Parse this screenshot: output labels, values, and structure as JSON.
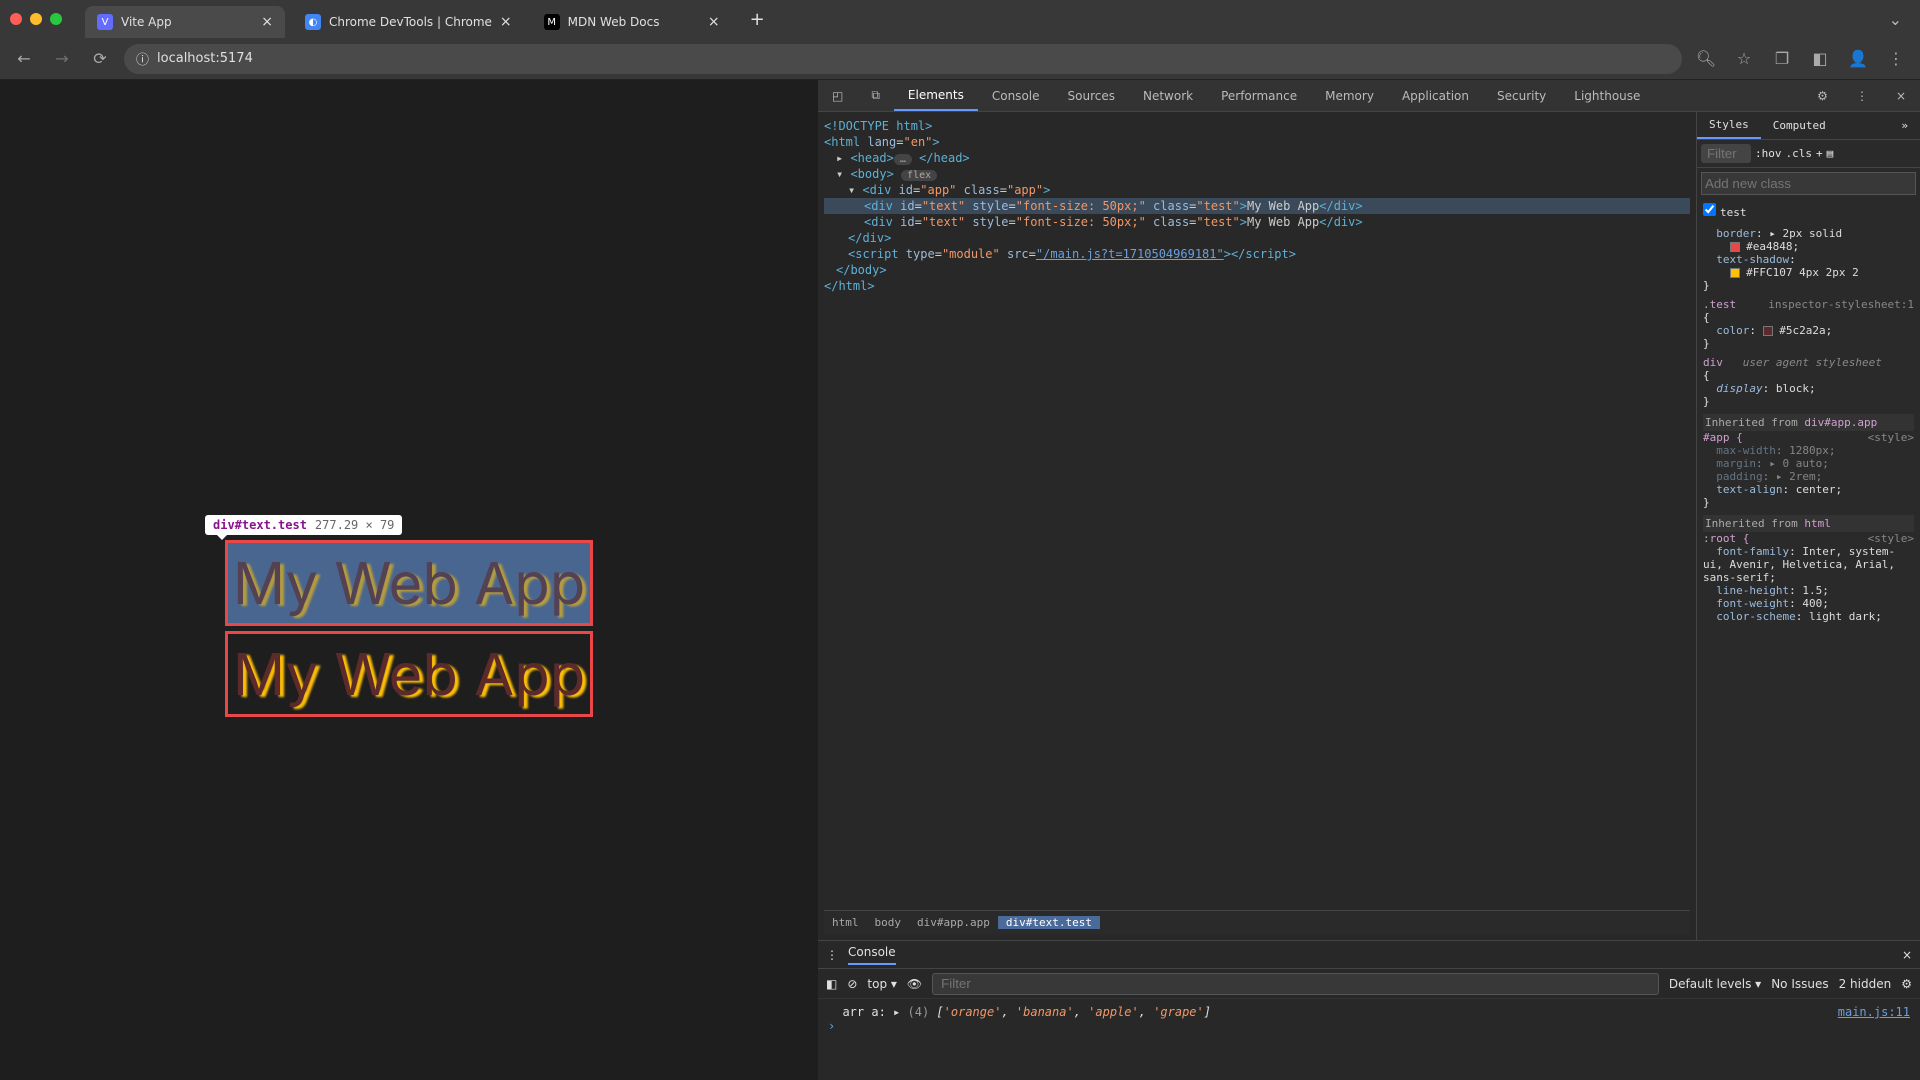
{
  "browser": {
    "tabs": [
      {
        "favicon_bg": "#646cff",
        "title": "Vite App"
      },
      {
        "favicon_bg": "#4285f4",
        "title": "Chrome DevTools | Chrome"
      },
      {
        "favicon_bg": "#000",
        "title": "MDN Web Docs"
      }
    ],
    "url": "localhost:5174"
  },
  "page": {
    "tooltip_selector": "div#text.test",
    "tooltip_dims": "277.29 × 79",
    "text1": "My Web App",
    "text2": "My Web App"
  },
  "devtools": {
    "tabs": [
      "Elements",
      "Console",
      "Sources",
      "Network",
      "Performance",
      "Memory",
      "Application",
      "Security",
      "Lighthouse"
    ],
    "active_tab": "Elements",
    "dom": {
      "l0": "<!DOCTYPE html>",
      "l1_open": "<html ",
      "l1_attr": "lang",
      "l1_val": "\"en\"",
      "l1_close": ">",
      "l2": "<head>",
      "l2b": "…",
      "l2c": "</head>",
      "l3": "<body>",
      "l3_pill": "flex",
      "l4_open": "<div ",
      "l4_a1": "id",
      "l4_v1": "\"app\"",
      "l4_a2": "class",
      "l4_v2": "\"app\"",
      "l4_close": ">",
      "l5_open": "<div ",
      "l5_a1": "id",
      "l5_v1": "\"text\"",
      "l5_a2": "style",
      "l5_v2": "\"font-size: 50px;\"",
      "l5_a3": "class",
      "l5_v3": "\"test\"",
      "l5_text": "My Web App",
      "l5_close": "</div>",
      "l6_open": "<div ",
      "l6_a1": "id",
      "l6_v1": "\"text\"",
      "l6_a2": "style",
      "l6_v2": "\"font-size: 50px;\"",
      "l6_a3": "class",
      "l6_v3": "\"test\"",
      "l6_text": "My Web App",
      "l6_close": "</div>",
      "l7": "</div>",
      "l8_open": "<script ",
      "l8_a1": "type",
      "l8_v1": "\"module\"",
      "l8_a2": "src",
      "l8_v2": "\"/main.js?t=1710504969181\"",
      "l8_close": "></script>",
      "l9": "</body>",
      "l10": "</html>"
    },
    "crumbs": [
      "html",
      "body",
      "div#app.app",
      "div#text.test"
    ],
    "styles": {
      "tabs": [
        "Styles",
        "Computed"
      ],
      "filter_placeholder": "Filter",
      "hov": ":hov",
      "cls": ".cls",
      "add_class_placeholder": "Add new class",
      "check_label": "test",
      "rule1_border_prop": "border",
      "rule1_border_val": "2px solid",
      "rule1_border_color": "#ea4848",
      "rule1_shadow_prop": "text-shadow",
      "rule1_shadow_color": "#FFC107",
      "rule1_shadow_rest": "4px 2px 2",
      "rule2_sel": ".test",
      "rule2_src": "inspector-stylesheet:1",
      "rule2_color_prop": "color",
      "rule2_color_val": "#5c2a2a",
      "rule3_sel": "div",
      "rule3_src": "user agent stylesheet",
      "rule3_display_prop": "display",
      "rule3_display_val": "block",
      "inh1": "Inherited from",
      "inh1_sel": "div#app.app",
      "rule4_sel": "#app {",
      "rule4_src": "<style>",
      "rule4_p1": "max-width",
      "rule4_v1": "1280px",
      "rule4_p2": "margin",
      "rule4_v2": "0 auto",
      "rule4_p3": "padding",
      "rule4_v3": "2rem",
      "rule4_p4": "text-align",
      "rule4_v4": "center",
      "inh2": "Inherited from",
      "inh2_sel": "html",
      "rule5_sel": ":root {",
      "rule5_src": "<style>",
      "rule5_p1": "font-family",
      "rule5_v1": "Inter, system-ui, Avenir, Helvetica, Arial, sans-serif",
      "rule5_p2": "line-height",
      "rule5_v2": "1.5",
      "rule5_p3": "font-weight",
      "rule5_v3": "400",
      "rule5_p4": "color-scheme",
      "rule5_v4": "light dark"
    }
  },
  "console": {
    "title": "Console",
    "context": "top",
    "filter_placeholder": "Filter",
    "levels": "Default levels",
    "issues": "No Issues",
    "hidden": "2 hidden",
    "log_prefix": "arr a:",
    "log_count": "(4)",
    "log_items": [
      "'orange'",
      "'banana'",
      "'apple'",
      "'grape'"
    ],
    "log_src": "main.js:11"
  }
}
